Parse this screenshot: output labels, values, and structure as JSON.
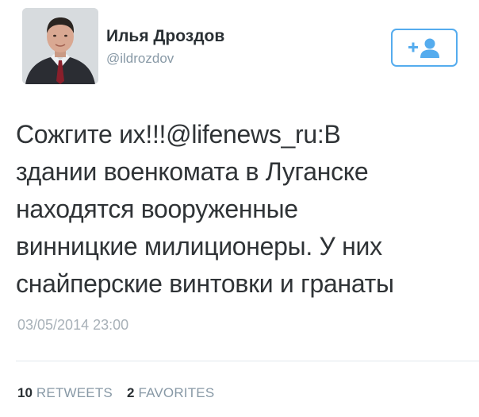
{
  "user": {
    "display_name": "Илья Дроздов",
    "username": "@ildrozdov"
  },
  "follow_button": {
    "icon": "follow-user-icon",
    "color": "#55acee"
  },
  "tweet": {
    "text": "Сожгите их!!!@lifenews_ru:В\nздании военкомата в Луганске\nнаходятся вооруженные\nвинницкие милиционеры. У них\nснайперские винтовки и  гранаты",
    "timestamp": "03/05/2014 23:00"
  },
  "stats": {
    "retweets_count": "10",
    "retweets_label": "RETWEETS",
    "favorites_count": "2",
    "favorites_label": "FAVORITES"
  }
}
